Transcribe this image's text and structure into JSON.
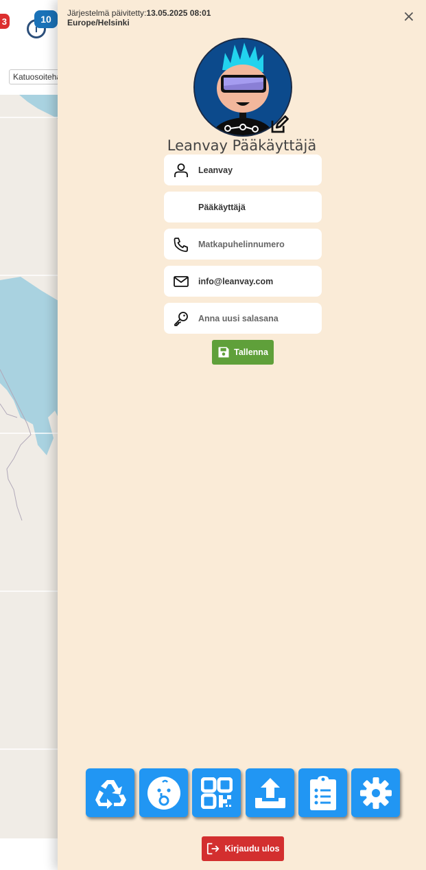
{
  "background": {
    "notification_count": "3",
    "info_count": "10",
    "info_icon_glyph": "i",
    "street_search_placeholder": "Katuosoitehaku"
  },
  "panel": {
    "system_updated_label": "Järjestelmä päivitetty:",
    "system_updated_value": "13.05.2025 08:01",
    "timezone": "Europe/Helsinki",
    "close_glyph": "×",
    "user_display_name": "Leanvay Pääkäyttäjä",
    "fields": {
      "first_name": "Leanvay",
      "last_name": "Pääkäyttäjä",
      "phone_placeholder": "Matkapuhelinnumero",
      "email": "info@leanvay.com",
      "password_placeholder": "Anna uusi salasana"
    },
    "save_label": "Tallenna",
    "logout_label": "Kirjaudu ulos",
    "toolbar_icons": [
      "recycle-icon",
      "baby-icon",
      "qr-code-icon",
      "upload-icon",
      "clipboard-list-icon",
      "settings-gear-icon"
    ]
  },
  "colors": {
    "panel_bg": "#faebd7",
    "toolbar_blue": "#2196f3",
    "save_green": "#5fa03a",
    "logout_red": "#d32f2f",
    "badge_blue": "#1a72b8",
    "badge_red": "#dc2f2f"
  }
}
